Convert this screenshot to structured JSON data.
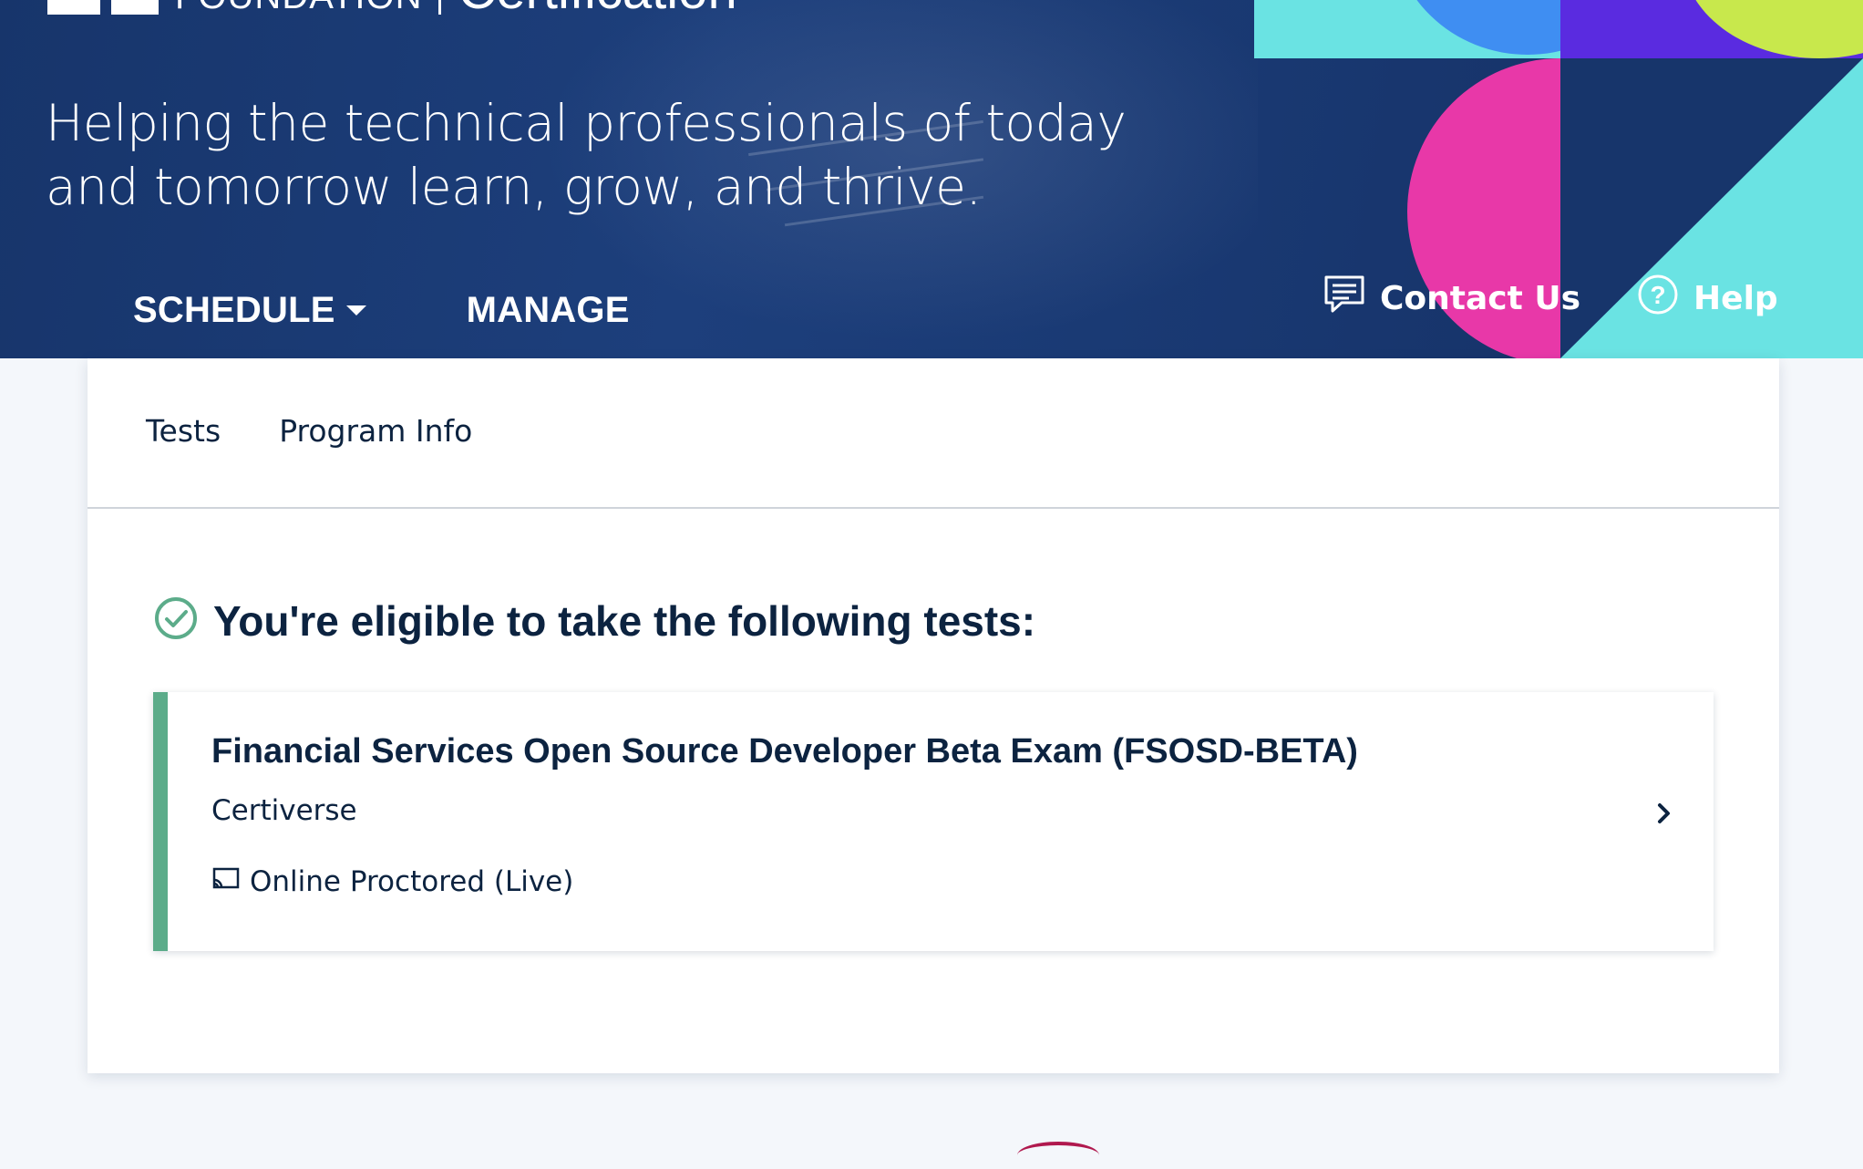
{
  "header": {
    "logo": {
      "foundation": "FOUNDATION",
      "product": "Certification"
    },
    "tagline_lines": [
      "Helping the technical professionals of today",
      "and tomorrow learn, grow, and thrive."
    ],
    "nav": {
      "schedule": "SCHEDULE",
      "manage": "MANAGE",
      "contact": "Contact Us",
      "help": "Help"
    },
    "icons": {
      "contact": "chat-icon",
      "help": "help-circle-icon",
      "schedule_dropdown": "caret-down-icon"
    }
  },
  "tabs": [
    "Tests",
    "Program Info"
  ],
  "eligible": {
    "title": "You're eligible to take the following tests:",
    "icon": "check-circle-icon"
  },
  "exams": [
    {
      "title": "Financial Services Open Source Developer Beta Exam (FSOSD-BETA)",
      "provider": "Certiverse",
      "delivery": "Online Proctored (Live)",
      "delivery_icon": "cast-screen-icon"
    }
  ],
  "colors": {
    "header_bg": "#1a3a74",
    "text_navy": "#0c2340",
    "success_green": "#5cac8a",
    "art_cyan": "#6ae3e3",
    "art_blue": "#3f8ef2",
    "art_purple": "#5a2be0",
    "art_pink": "#e838a8",
    "art_lime": "#c8e84c"
  }
}
